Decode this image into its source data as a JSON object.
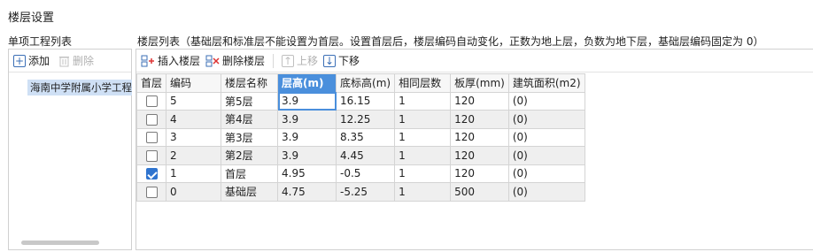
{
  "window": {
    "title": "楼层设置"
  },
  "left": {
    "caption": "单项工程列表",
    "toolbar": {
      "add_label": "添加",
      "delete_label": "删除"
    },
    "projects": [
      "海南中学附属小学工程"
    ]
  },
  "right": {
    "caption": "楼层列表（基础层和标准层不能设置为首层。设置首层后，楼层编码自动变化，正数为地上层，负数为地下层，基础层编码固定为 0）",
    "toolbar": {
      "insert_label": "插入楼层",
      "delete_label": "删除楼层",
      "up_label": "上移",
      "down_label": "下移"
    },
    "columns": [
      "首层",
      "编码",
      "楼层名称",
      "层高(m)",
      "底标高(m)",
      "相同层数",
      "板厚(mm)",
      "建筑面积(m2)"
    ],
    "active_column": "层高(m)",
    "rows": [
      {
        "first": false,
        "code": "5",
        "name": "第5层",
        "height": "3.9",
        "bottom": "16.15",
        "same": "1",
        "slab": "120",
        "area": "(0)"
      },
      {
        "first": false,
        "code": "4",
        "name": "第4层",
        "height": "3.9",
        "bottom": "12.25",
        "same": "1",
        "slab": "120",
        "area": "(0)"
      },
      {
        "first": false,
        "code": "3",
        "name": "第3层",
        "height": "3.9",
        "bottom": "8.35",
        "same": "1",
        "slab": "120",
        "area": "(0)"
      },
      {
        "first": false,
        "code": "2",
        "name": "第2层",
        "height": "3.9",
        "bottom": "4.45",
        "same": "1",
        "slab": "120",
        "area": "(0)"
      },
      {
        "first": true,
        "code": "1",
        "name": "首层",
        "height": "4.95",
        "bottom": "-0.5",
        "same": "1",
        "slab": "120",
        "area": "(0)"
      },
      {
        "first": false,
        "code": "0",
        "name": "基础层",
        "height": "4.75",
        "bottom": "-5.25",
        "same": "1",
        "slab": "500",
        "area": "(0)"
      }
    ]
  }
}
